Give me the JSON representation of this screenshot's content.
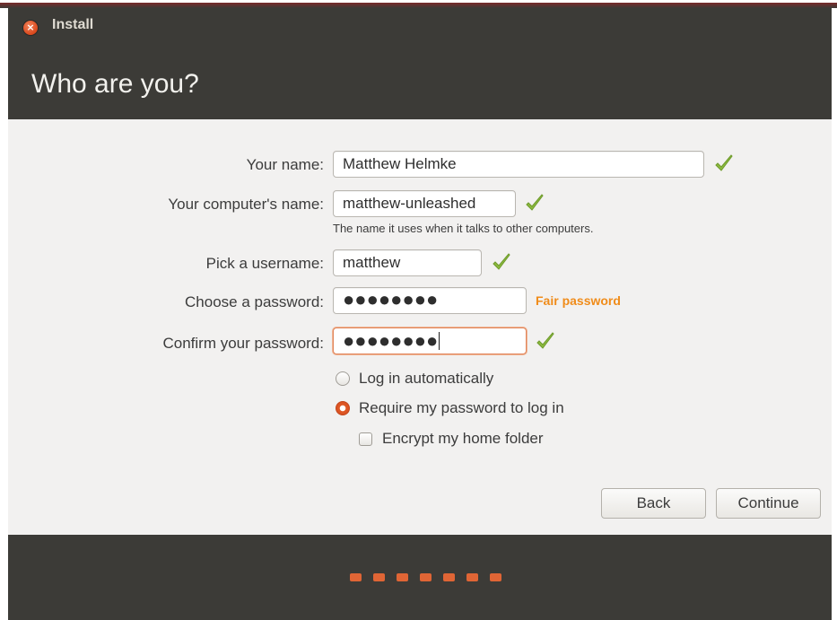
{
  "window": {
    "title": "Install",
    "close_glyph": "×",
    "heading": "Who are you?"
  },
  "form": {
    "name_label": "Your name:",
    "name_value": "Matthew Helmke",
    "computer_label": "Your computer's name:",
    "computer_value": "matthew-unleashed",
    "computer_hint": "The name it uses when it talks to other computers.",
    "username_label": "Pick a username:",
    "username_value": "matthew",
    "password_label": "Choose a password:",
    "password_mask": "●●●●●●●●",
    "password_strength": "Fair password",
    "confirm_label": "Confirm your password:",
    "confirm_mask": "●●●●●●●●"
  },
  "login_options": {
    "auto_login_label": "Log in automatically",
    "require_password_label": "Require my password to log in",
    "selected": "require_password",
    "encrypt_label": "Encrypt my home folder",
    "encrypt_checked": false
  },
  "buttons": {
    "back": "Back",
    "continue": "Continue"
  },
  "progress": {
    "dot_count": 7
  },
  "colors": {
    "accent_orange": "#e06535",
    "check_green": "#8cba3f",
    "strength_orange": "#f08c1a",
    "chrome_dark": "#3c3b37",
    "content_bg": "#f2f1f0"
  },
  "icons": {
    "valid_mark": "checkmark-icon",
    "close": "close-icon"
  }
}
